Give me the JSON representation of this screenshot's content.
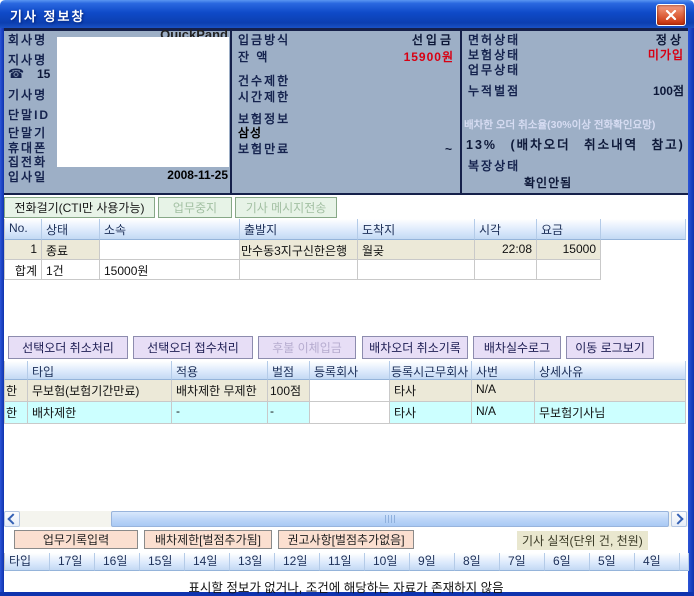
{
  "window": {
    "title": "기사 정보창"
  },
  "panels": {
    "left": {
      "company_label": "회사명",
      "company_value_clipped": "QuickPand",
      "branch_label": "지사명",
      "phone_label": "☎",
      "phone_value": "15",
      "driver_label": "기사명",
      "terminal_id_label": "단말ID",
      "terminal_label": "단말기",
      "mobile_label": "휴대폰",
      "home_phone_label": "집전화",
      "hire_date_label": "입사일",
      "hire_date_value": "2008-11-25"
    },
    "middle": {
      "deposit_method_label": "입금방식",
      "deposit_method_value": "선입금",
      "balance_label": "잔  액",
      "balance_value": "15900원",
      "count_limit_label": "건수제한",
      "time_limit_label": "시간제한",
      "insurance_info_label": "보험정보",
      "insurance_company": "삼성",
      "insurance_expiry_label": "보험만료",
      "insurance_expiry_value": "~"
    },
    "right": {
      "license_status_label": "면허상태",
      "license_status_value": "정상",
      "insurance_status_label": "보험상태",
      "insurance_status_value": "미가입",
      "work_status_label": "업무상태",
      "penalty_label": "누적벌점",
      "penalty_value": "100점",
      "cancel_rate_notice": "배차한 오더 취소율(30%이상 전화확인요망)",
      "cancel_rate_value": "13% (배차오더 취소내역 참고)",
      "dress_status_label": "복장상태",
      "dress_status_value": "확인안됨"
    }
  },
  "toolbar1": {
    "buttons": [
      {
        "label": "전화걸기(CTI만 사용가능)",
        "enabled": true
      },
      {
        "label": "업무중지",
        "enabled": false
      },
      {
        "label": "기사 메시지전송",
        "enabled": false
      }
    ]
  },
  "orders_table": {
    "headers": [
      "No.",
      "상태",
      "소속",
      "출발지",
      "도착지",
      "시각",
      "요금"
    ],
    "rows": [
      [
        "1",
        "종료",
        "",
        "만수동3지구신한은행",
        "월곶",
        "22:08",
        "15000"
      ],
      [
        "합계",
        "1건",
        "15000원",
        "",
        "",
        "",
        ""
      ]
    ]
  },
  "toolbar2": {
    "buttons": [
      {
        "label": "선택오더 취소처리",
        "enabled": true
      },
      {
        "label": "선택오더 접수처리",
        "enabled": true
      },
      {
        "label": "후불 이체입금",
        "enabled": false
      },
      {
        "label": "배차오더 취소기록",
        "enabled": true
      },
      {
        "label": "배차실수로그",
        "enabled": true
      },
      {
        "label": "이동 로그보기",
        "enabled": true
      }
    ]
  },
  "penalty_table": {
    "headers": [
      "",
      "타입",
      "적용",
      "벌점",
      "등록회사",
      "등록시근무회사",
      "사번",
      "상세사유"
    ],
    "rows": [
      [
        "한",
        "무보험(보험기간만료)",
        "배차제한 무제한",
        "100점",
        "",
        "타사",
        "N/A",
        ""
      ],
      [
        "한",
        "배차제한",
        "-",
        "-",
        "",
        "타사",
        "N/A",
        "무보험기사님"
      ]
    ]
  },
  "toolbar3": {
    "buttons": [
      {
        "label": "업무기록입력"
      },
      {
        "label": "배차제한[벌점추가됨]"
      },
      {
        "label": "권고사항[벌점추가없음]"
      }
    ],
    "performance_label": "기사 실적(단위 건, 천원)"
  },
  "daily_table": {
    "headers": [
      "타입",
      "17일",
      "16일",
      "15일",
      "14일",
      "13일",
      "12일",
      "11일",
      "10일",
      "9일",
      "8일",
      "7일",
      "6일",
      "5일",
      "4일"
    ]
  },
  "footer": {
    "empty_message": "표시할 정보가 없거나, 조건에 해당하는 자료가 존재하지 않음"
  },
  "colors": {
    "accent_red": "#d80012",
    "panel_bg": "#9dafc6",
    "row_highlight": "#ece9d8",
    "row_cyan": "#ccffff",
    "titlebar_blue": "#0f4ac8"
  }
}
